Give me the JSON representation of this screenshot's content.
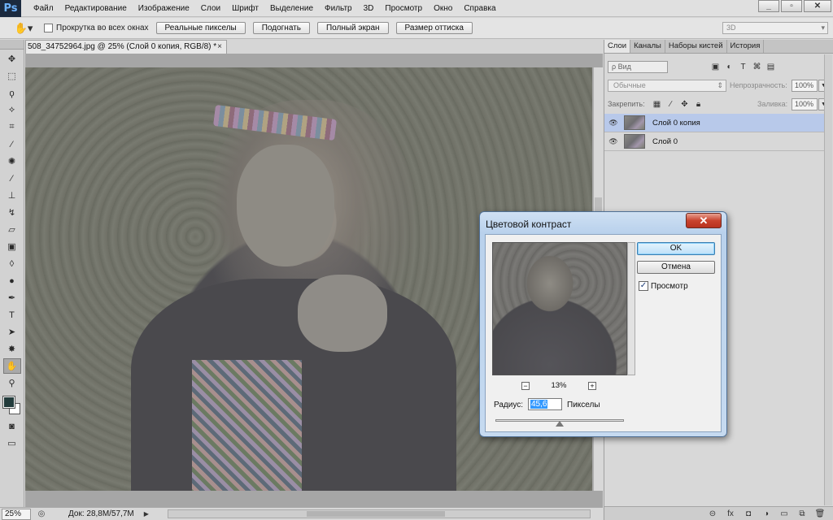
{
  "app": {
    "logo": "Ps"
  },
  "menu": [
    "Файл",
    "Редактирование",
    "Изображение",
    "Слои",
    "Шрифт",
    "Выделение",
    "Фильтр",
    "3D",
    "Просмотр",
    "Окно",
    "Справка"
  ],
  "window_controls": {
    "minimize": "_",
    "restore": "▫",
    "close": "✕"
  },
  "options_bar": {
    "scroll_all_label": "Прокрутка во всех окнах",
    "buttons": [
      "Реальные пикселы",
      "Подогнать",
      "Полный экран",
      "Размер оттиска"
    ],
    "workspace": "3D"
  },
  "document": {
    "tab_title": "508_34752964.jpg @ 25% (Слой 0 копия, RGB/8) *",
    "tab_close": "×"
  },
  "status": {
    "zoom": "25%",
    "doc_size": "Док: 28,8М/57,7М"
  },
  "panels": {
    "tabs": [
      "Слои",
      "Каналы",
      "Наборы кистей",
      "История"
    ],
    "filter_label": "ρ Вид",
    "blend_mode": "Обычные",
    "opacity_label": "Непрозрачность:",
    "opacity_value": "100%",
    "lock_label": "Закрепить:",
    "fill_label": "Заливка:",
    "fill_value": "100%",
    "layers": [
      {
        "name": "Слой 0 копия",
        "selected": true
      },
      {
        "name": "Слой 0",
        "selected": false
      }
    ]
  },
  "dialog": {
    "title": "Цветовой контраст",
    "ok_label": "OK",
    "cancel_label": "Отмена",
    "preview_label": "Просмотр",
    "preview_checked": true,
    "zoom_value": "13%",
    "radius_label": "Радиус:",
    "radius_value": "45,6",
    "unit_label": "Пикселы",
    "radius_slider_fraction": 0.5
  },
  "colors": {
    "foreground": "#233c3c",
    "background": "#ffffff",
    "selection": "#b8c9ea",
    "close_red": "#c9432e"
  }
}
